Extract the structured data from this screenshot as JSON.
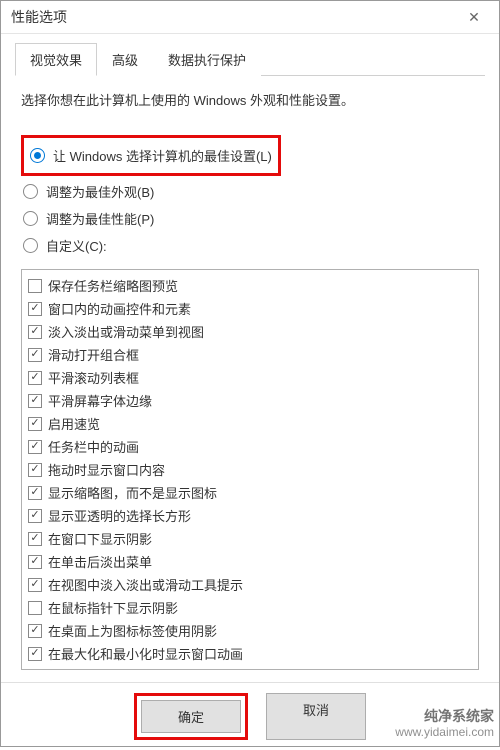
{
  "window": {
    "title": "性能选项",
    "close_label": "✕"
  },
  "tabs": [
    {
      "label": "视觉效果",
      "active": true
    },
    {
      "label": "高级",
      "active": false
    },
    {
      "label": "数据执行保护",
      "active": false
    }
  ],
  "description": "选择你想在此计算机上使用的 Windows 外观和性能设置。",
  "radios": [
    {
      "label": "让 Windows 选择计算机的最佳设置(L)",
      "checked": true,
      "highlighted": true
    },
    {
      "label": "调整为最佳外观(B)",
      "checked": false
    },
    {
      "label": "调整为最佳性能(P)",
      "checked": false
    },
    {
      "label": "自定义(C):",
      "checked": false
    }
  ],
  "options": [
    {
      "label": "保存任务栏缩略图预览",
      "checked": false
    },
    {
      "label": "窗口内的动画控件和元素",
      "checked": true
    },
    {
      "label": "淡入淡出或滑动菜单到视图",
      "checked": true
    },
    {
      "label": "滑动打开组合框",
      "checked": true
    },
    {
      "label": "平滑滚动列表框",
      "checked": true
    },
    {
      "label": "平滑屏幕字体边缘",
      "checked": true
    },
    {
      "label": "启用速览",
      "checked": true
    },
    {
      "label": "任务栏中的动画",
      "checked": true
    },
    {
      "label": "拖动时显示窗口内容",
      "checked": true
    },
    {
      "label": "显示缩略图，而不是显示图标",
      "checked": true
    },
    {
      "label": "显示亚透明的选择长方形",
      "checked": true
    },
    {
      "label": "在窗口下显示阴影",
      "checked": true
    },
    {
      "label": "在单击后淡出菜单",
      "checked": true
    },
    {
      "label": "在视图中淡入淡出或滑动工具提示",
      "checked": true
    },
    {
      "label": "在鼠标指针下显示阴影",
      "checked": false
    },
    {
      "label": "在桌面上为图标标签使用阴影",
      "checked": true
    },
    {
      "label": "在最大化和最小化时显示窗口动画",
      "checked": true
    }
  ],
  "buttons": {
    "ok": "确定",
    "cancel": "取消"
  },
  "watermark": {
    "line1": "纯净系统家",
    "line2": "www.yidaimei.com"
  }
}
